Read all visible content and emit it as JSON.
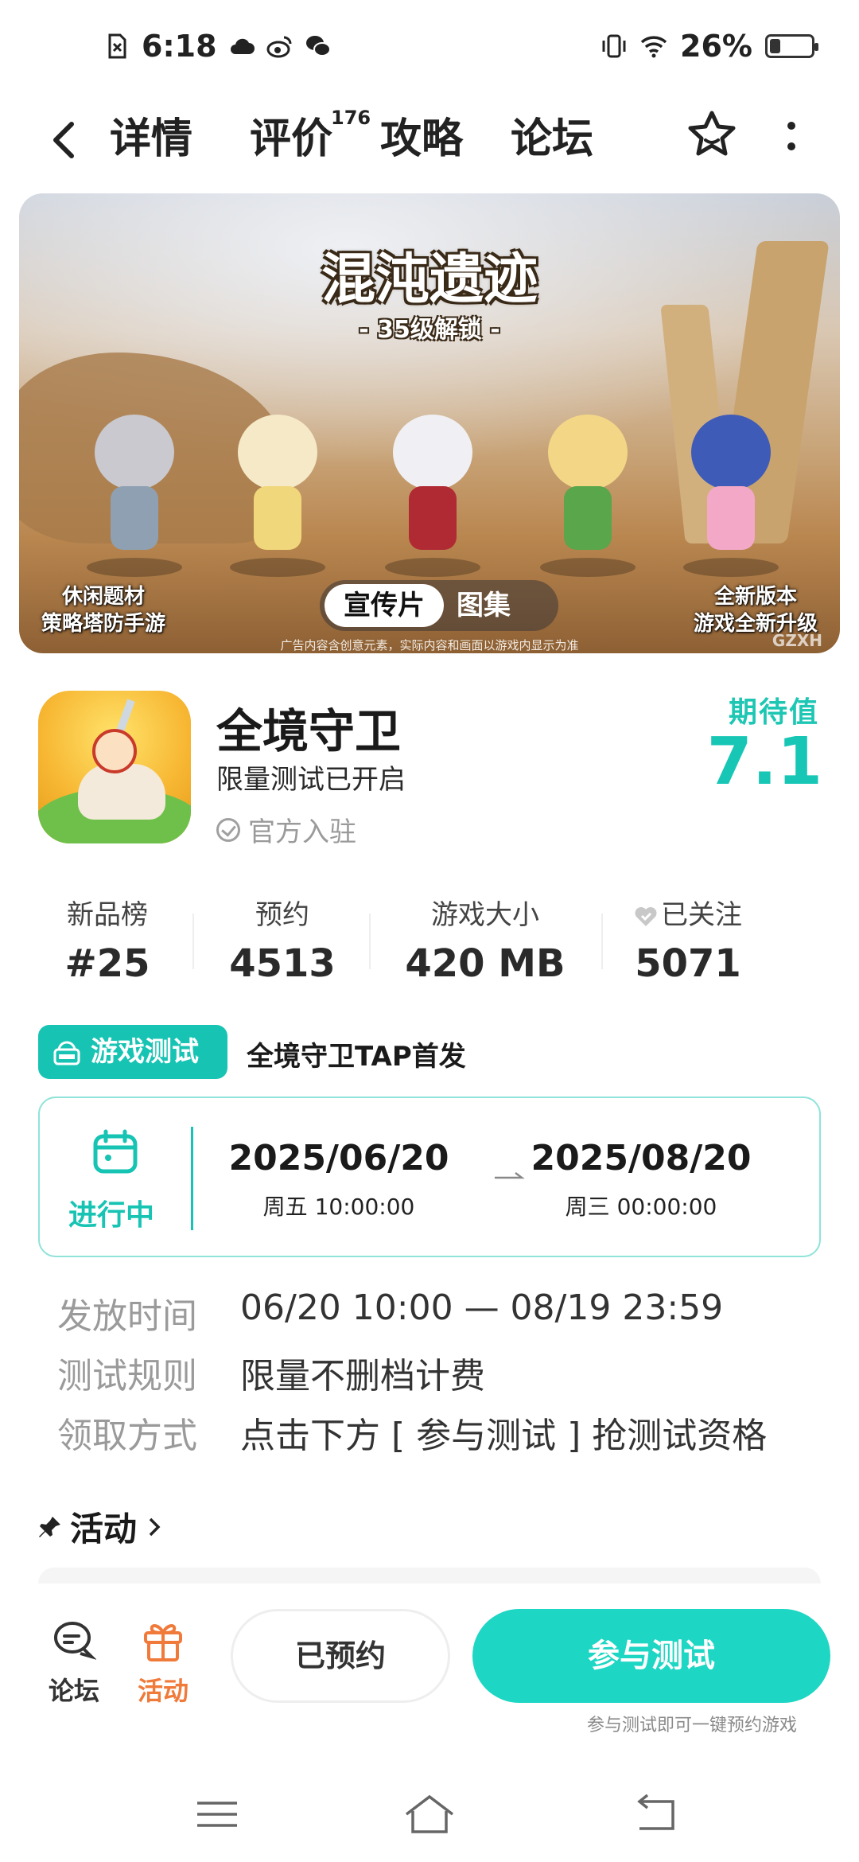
{
  "status_bar": {
    "time": "6:18",
    "battery": "26%",
    "battery_level": 0.26
  },
  "nav": {
    "tabs": [
      {
        "label": "详情",
        "active": true
      },
      {
        "label": "评价",
        "badge": "176"
      },
      {
        "label": "攻略"
      },
      {
        "label": "论坛"
      }
    ]
  },
  "banner": {
    "title": "混沌遗迹",
    "subtitle": "- 35级解锁 -",
    "left_caption_1": "休闲题材",
    "left_caption_2": "策略塔防手游",
    "right_caption_1": "全新版本",
    "right_caption_2": "游戏全新升级",
    "media_active": "宣传片",
    "media_other": "图集",
    "disclaimer": "广告内容含创意元素，实际内容和画面以游戏内显示为准",
    "watermark": "GZXH"
  },
  "app": {
    "name": "全境守卫",
    "status": "限量测试已开启",
    "official": "官方入驻",
    "expect_label": "期待值",
    "expect_value": "7.1"
  },
  "stats": [
    {
      "label": "新品榜",
      "value": "#25"
    },
    {
      "label": "预约",
      "value": "4513"
    },
    {
      "label": "游戏大小",
      "value": "420 MB"
    },
    {
      "label": "已关注",
      "value": "5071"
    }
  ],
  "test": {
    "tag": "游戏测试",
    "title": "全境守卫TAP首发",
    "status": "进行中",
    "start_date": "2025/06/20",
    "start_time": "周五  10:00:00",
    "end_date": "2025/08/20",
    "end_time": "周三  00:00:00",
    "info": [
      {
        "label": "发放时间",
        "value": "06/20 10:00 — 08/19 23:59"
      },
      {
        "label": "测试规则",
        "value": "限量不删档计费"
      },
      {
        "label": "领取方式",
        "value": "点击下方 [ 参与测试 ] 抢测试资格"
      }
    ]
  },
  "activity": {
    "title": "活动"
  },
  "action_bar": {
    "forum_label": "论坛",
    "activity_label": "活动",
    "reserved_label": "已预约",
    "join_label": "参与测试",
    "join_hint": "参与测试即可一键预约游戏"
  },
  "colors": {
    "accent": "#1dd6c3",
    "accent_dark": "#17c4b3",
    "activity_orange": "#f07a3a"
  }
}
